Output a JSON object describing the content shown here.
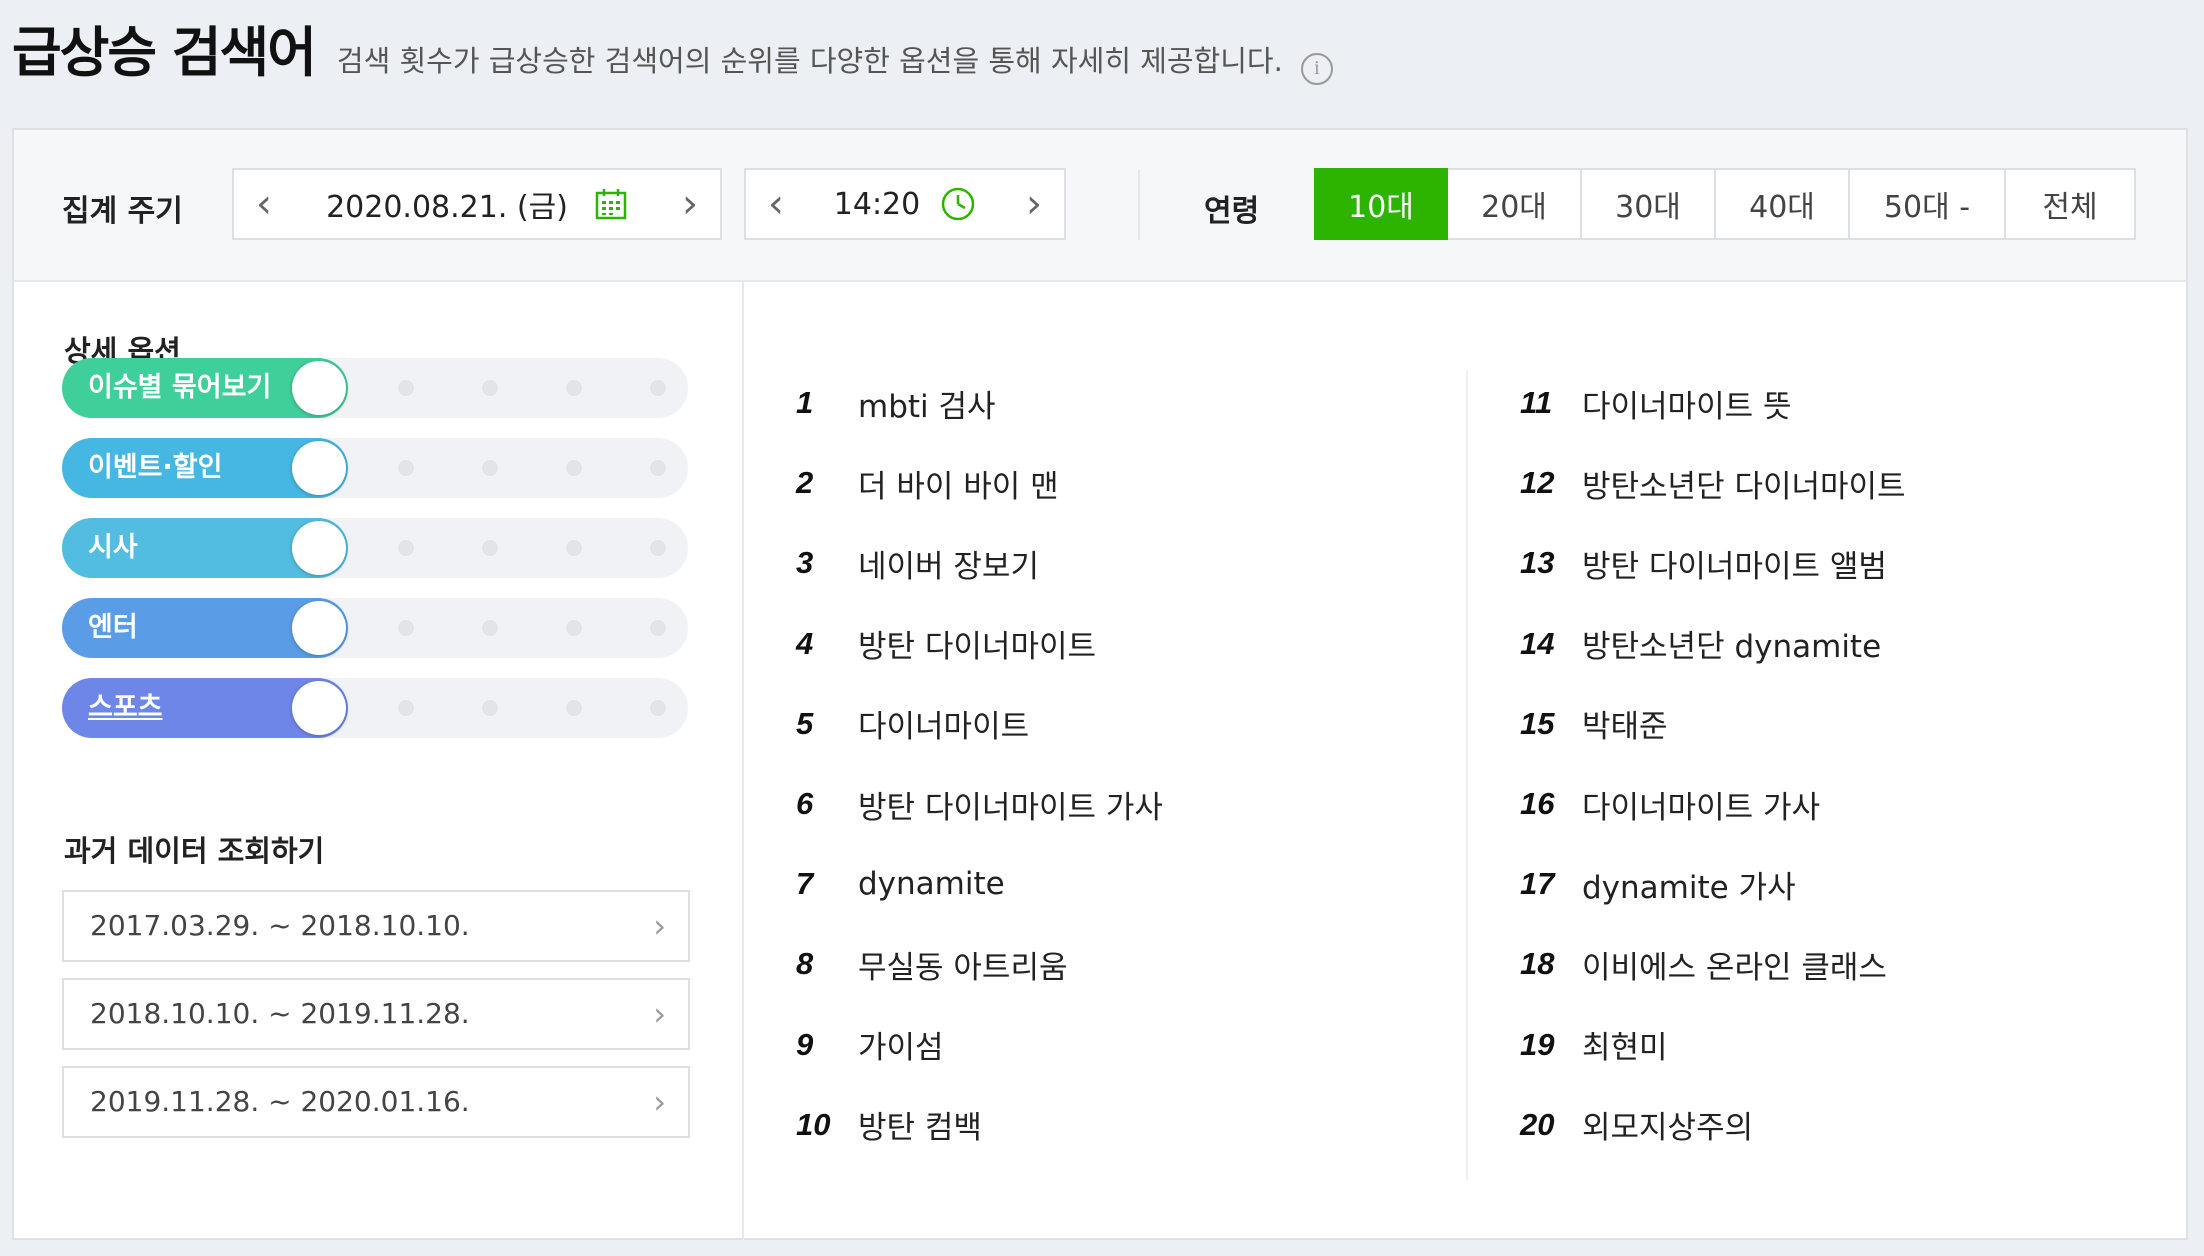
{
  "header": {
    "title": "급상승 검색어",
    "description": "검색 횟수가 급상승한 검색어의 순위를 다양한 옵션을 통해 자세히 제공합니다.",
    "info_glyph": "i"
  },
  "filters": {
    "period_label": "집계 주기",
    "date": "2020.08.21. (금)",
    "time": "14:20",
    "prev_glyph": "‹",
    "next_glyph": "›",
    "age_label": "연령",
    "ages": [
      "10대",
      "20대",
      "30대",
      "40대",
      "50대 -",
      "전체"
    ],
    "active_age": "10대"
  },
  "options": {
    "title": "상세 옵션",
    "toggles": [
      {
        "label": "이슈별 묶어보기",
        "color": "#3fcf9a"
      },
      {
        "label": "이벤트·할인",
        "color": "#46b7e3"
      },
      {
        "label": "시사",
        "color": "#52bde0"
      },
      {
        "label": "엔터",
        "color": "#5a9de6"
      },
      {
        "label": "스포츠",
        "color": "#6e86e8"
      }
    ]
  },
  "past": {
    "title": "과거 데이터 조회하기",
    "ranges": [
      "2017.03.29. ~ 2018.10.10.",
      "2018.10.10. ~ 2019.11.28.",
      "2019.11.28. ~ 2020.01.16."
    ],
    "arrow_glyph": "›"
  },
  "ranking": {
    "left": [
      {
        "rank": "1",
        "term": "mbti 검사"
      },
      {
        "rank": "2",
        "term": "더 바이 바이 맨"
      },
      {
        "rank": "3",
        "term": "네이버 장보기"
      },
      {
        "rank": "4",
        "term": "방탄 다이너마이트"
      },
      {
        "rank": "5",
        "term": "다이너마이트"
      },
      {
        "rank": "6",
        "term": "방탄 다이너마이트 가사"
      },
      {
        "rank": "7",
        "term": "dynamite"
      },
      {
        "rank": "8",
        "term": "무실동 아트리움"
      },
      {
        "rank": "9",
        "term": "가이섬"
      },
      {
        "rank": "10",
        "term": "방탄 컴백"
      }
    ],
    "right": [
      {
        "rank": "11",
        "term": "다이너마이트 뜻"
      },
      {
        "rank": "12",
        "term": "방탄소년단 다이너마이트"
      },
      {
        "rank": "13",
        "term": "방탄 다이너마이트 앨범"
      },
      {
        "rank": "14",
        "term": "방탄소년단 dynamite"
      },
      {
        "rank": "15",
        "term": "박태준"
      },
      {
        "rank": "16",
        "term": "다이너마이트 가사"
      },
      {
        "rank": "17",
        "term": "dynamite 가사"
      },
      {
        "rank": "18",
        "term": "이비에스 온라인 클래스"
      },
      {
        "rank": "19",
        "term": "최현미"
      },
      {
        "rank": "20",
        "term": "외모지상주의"
      }
    ]
  }
}
